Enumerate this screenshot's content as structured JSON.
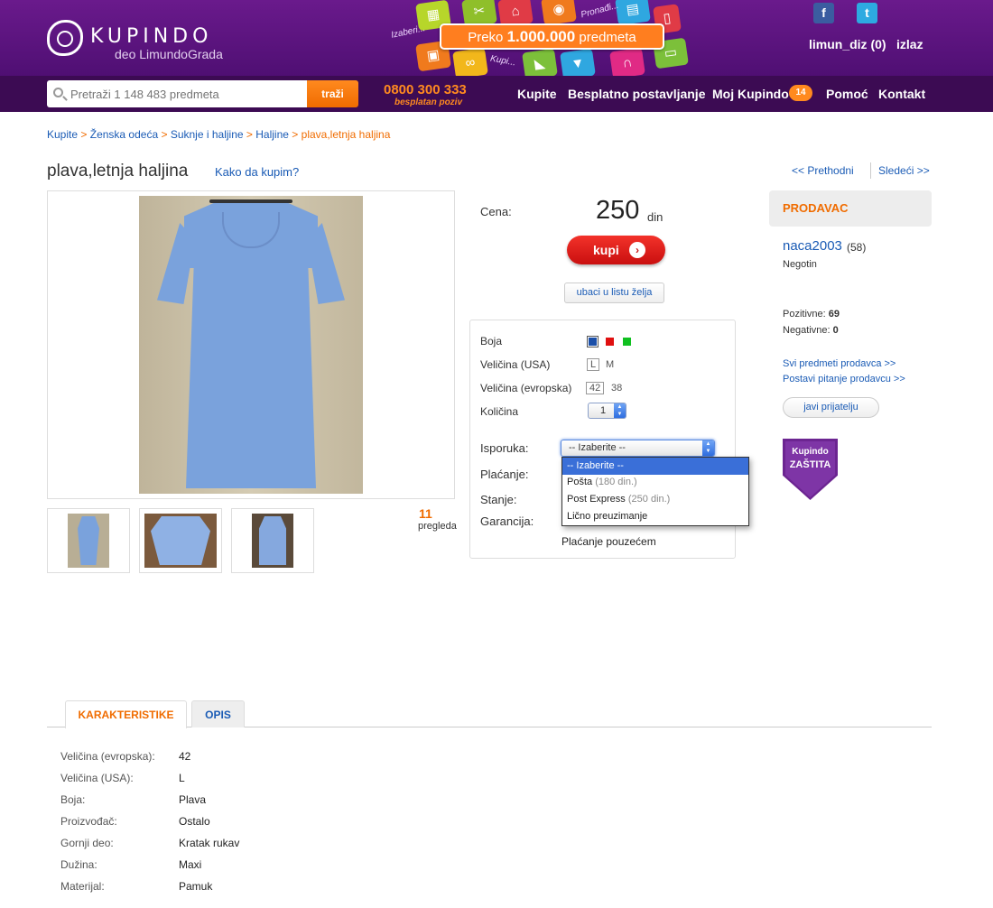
{
  "header": {
    "brand": "KUPINDO",
    "brand_sub": "deo LimundoGrada",
    "promo_prefix": "Preko",
    "promo_number": "1.000.000",
    "promo_suffix": "predmeta",
    "tile_words": [
      "Izaberi...",
      "Pronađi...",
      "Kupi..."
    ],
    "facebook": "f",
    "twitter": "t",
    "user": "limun_diz (0)",
    "logout": "izlaz"
  },
  "nav": {
    "search_placeholder": "Pretraži 1 148 483 predmeta",
    "search_button": "traži",
    "phone": "0800 300 333",
    "phone_sub": "besplatan poziv",
    "items": [
      "Kupite",
      "Besplatno postavljanje",
      "Moj Kupindo",
      "Pomoć",
      "Kontakt"
    ],
    "badge": "14"
  },
  "breadcrumb": {
    "links": [
      "Kupite",
      "Ženska odeća",
      "Suknje i haljine",
      "Haljine"
    ],
    "current": "plava,letnja haljina",
    "separator": ">"
  },
  "product": {
    "title": "plava,letnja haljina",
    "how_to_buy": "Kako da kupim?",
    "prev": "<< Prethodni",
    "next": "Sledeći >>",
    "views": "11",
    "views_label": "pregleda"
  },
  "purchase": {
    "price_label": "Cena:",
    "price": "250",
    "currency": "din",
    "buy": "kupi",
    "wishlist": "ubaci u listu želja",
    "color_label": "Boja",
    "size_us_label": "Veličina (USA)",
    "size_us_options": [
      "L",
      "M"
    ],
    "size_eu_label": "Veličina (evropska)",
    "size_eu_options": [
      "42",
      "38"
    ],
    "qty_label": "Količina",
    "qty_value": "1",
    "shipping_label": "Isporuka:",
    "shipping_value": "-- Izaberite --",
    "shipping_options": [
      {
        "label": "-- Izaberite --",
        "price": ""
      },
      {
        "label": "Pošta",
        "price": "(180 din.)"
      },
      {
        "label": "Post Express",
        "price": "(250 din.)"
      },
      {
        "label": "Lično preuzimanje",
        "price": ""
      }
    ],
    "payment_label": "Plaćanje:",
    "condition_label": "Stanje:",
    "warranty_label": "Garancija:",
    "payment_value": "Plaćanje pouzećem",
    "colors": [
      "#1b4fa8",
      "#e01010",
      "#10c020"
    ]
  },
  "seller": {
    "header": "PRODAVAC",
    "name": "naca2003",
    "score": "(58)",
    "city": "Negotin",
    "positive_label": "Pozitivne:",
    "positive": "69",
    "negative_label": "Negativne:",
    "negative": "0",
    "all_items": "Svi predmeti prodavca >>",
    "ask": "Postavi pitanje prodavcu >>",
    "tell_friend": "javi prijatelju",
    "protection_1": "Kupindo",
    "protection_2": "ZAŠTITA"
  },
  "tabs": [
    "KARAKTERISTIKE",
    "OPIS"
  ],
  "attributes": [
    {
      "key": "Veličina (evropska):",
      "value": "42"
    },
    {
      "key": "Veličina (USA):",
      "value": "L"
    },
    {
      "key": "Boja:",
      "value": "Plava"
    },
    {
      "key": "Proizvođač:",
      "value": "Ostalo"
    },
    {
      "key": "Gornji deo:",
      "value": "Kratak rukav"
    },
    {
      "key": "Dužina:",
      "value": "Maxi"
    },
    {
      "key": "Materijal:",
      "value": "Pamuk"
    }
  ],
  "colors": {
    "purple": "#4f0f73",
    "nav_dark": "#3c0b53",
    "orange": "#f06c00",
    "link": "#1a5bb5",
    "buy_red": "#d81818"
  }
}
